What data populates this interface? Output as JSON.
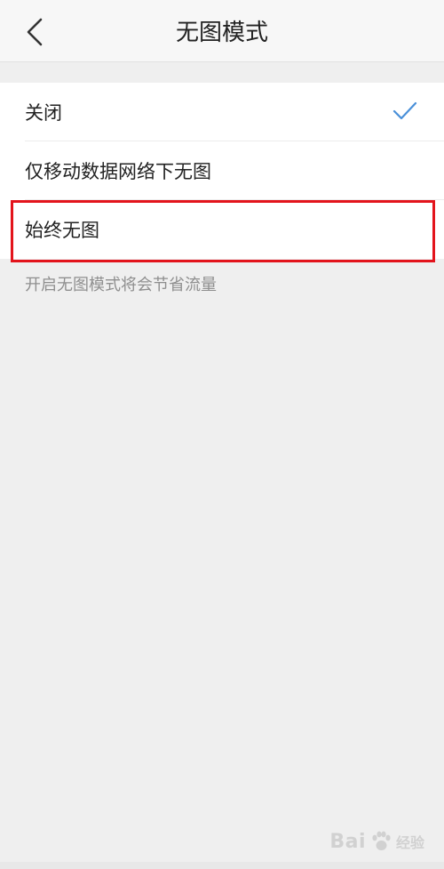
{
  "header": {
    "title": "无图模式",
    "back_icon": "chevron-left-icon"
  },
  "options": [
    {
      "label": "关闭",
      "selected": true
    },
    {
      "label": "仅移动数据网络下无图",
      "selected": false
    },
    {
      "label": "始终无图",
      "selected": false,
      "highlighted": true
    }
  ],
  "hint": "开启无图模式将会节省流量",
  "colors": {
    "accent_check": "#4a90d9",
    "highlight_border": "#e3141c",
    "background": "#efefef"
  },
  "watermark": {
    "brand": "Bai",
    "suffix": "经验",
    "icon": "paw-icon"
  }
}
